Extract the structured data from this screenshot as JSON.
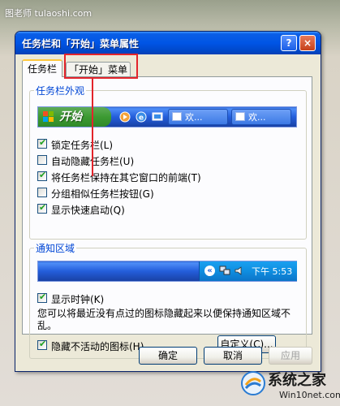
{
  "watermark": {
    "top_text": "图老师 tulaoshi.com",
    "logo_text": "系统之家",
    "logo_url": "Win10net.com"
  },
  "window": {
    "title": "任务栏和「开始」菜单属性",
    "help_glyph": "?",
    "close_glyph": "×"
  },
  "tabs": [
    {
      "label": "任务栏",
      "active": true
    },
    {
      "label": "「开始」菜单",
      "active": false
    }
  ],
  "annotation": {
    "color": "#e3242b"
  },
  "appearance": {
    "title": "任务栏外观",
    "preview": {
      "start_label": "开始",
      "task_buttons": [
        "欢...",
        "欢..."
      ]
    },
    "options": [
      {
        "label": "锁定任务栏(L)",
        "checked": true
      },
      {
        "label": "自动隐藏任务栏(U)",
        "checked": false
      },
      {
        "label": "将任务栏保持在其它窗口的前端(T)",
        "checked": true
      },
      {
        "label": "分组相似任务栏按钮(G)",
        "checked": false
      },
      {
        "label": "显示快速启动(Q)",
        "checked": true
      }
    ]
  },
  "notification": {
    "title": "通知区域",
    "preview": {
      "expand_glyph": "«",
      "clock": "下午 5:53"
    },
    "show_clock": {
      "label": "显示时钟(K)",
      "checked": true
    },
    "description": "您可以将最近没有点过的图标隐藏起来以便保持通知区域不乱。",
    "hide_inactive": {
      "label": "隐藏不活动的图标(H)",
      "checked": true
    },
    "customize_label": "自定义(C)..."
  },
  "footer": {
    "ok_label": "确定",
    "cancel_label": "取消",
    "apply_label": "应用"
  },
  "colors": {
    "titlebar": "#0055e5",
    "dialog_bg": "#ece9d8",
    "group_title": "#0046d5",
    "check": "#21a121"
  }
}
